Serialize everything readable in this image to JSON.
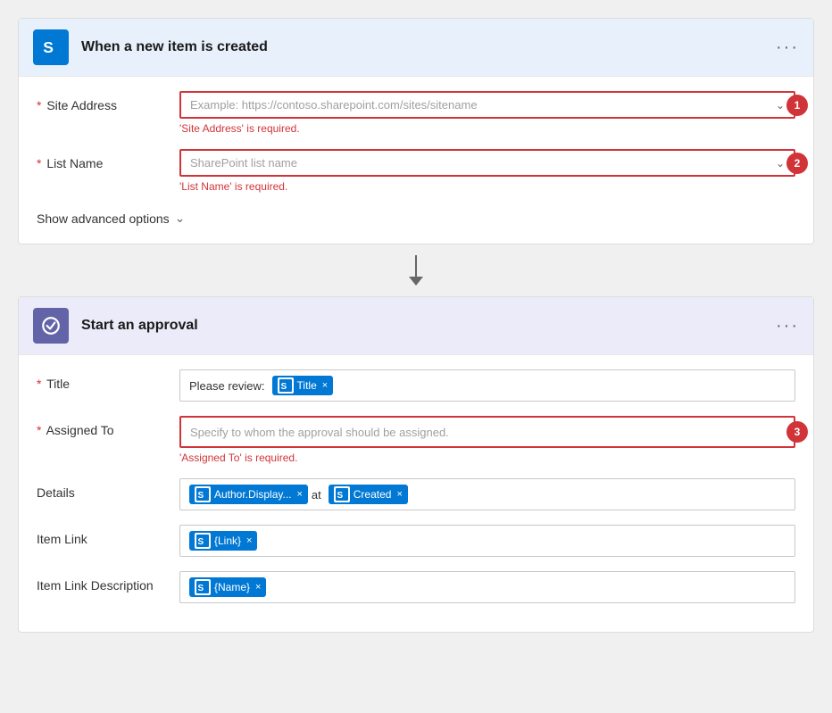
{
  "trigger_card": {
    "title": "When a new item is created",
    "icon_label": "S",
    "menu_dots": "···",
    "site_address": {
      "label": "Site Address",
      "required": true,
      "placeholder": "Example: https://contoso.sharepoint.com/sites/sitename",
      "error": "'Site Address' is required.",
      "step_badge": "1"
    },
    "list_name": {
      "label": "List Name",
      "required": true,
      "placeholder": "SharePoint list name",
      "error": "'List Name' is required.",
      "step_badge": "2"
    },
    "advanced_options": {
      "label": "Show advanced options"
    }
  },
  "approval_card": {
    "title": "Start an approval",
    "icon_label": "✓",
    "menu_dots": "···",
    "title_field": {
      "label": "Title",
      "required": true,
      "prefix_text": "Please review:",
      "token_label": "Title",
      "token_icon": "S"
    },
    "assigned_to": {
      "label": "Assigned To",
      "required": true,
      "placeholder": "Specify to whom the approval should be assigned.",
      "error": "'Assigned To' is required.",
      "step_badge": "3"
    },
    "details": {
      "label": "Details",
      "token1_label": "Author.Display...",
      "token1_icon": "S",
      "separator": "at",
      "token2_label": "Created",
      "token2_icon": "S"
    },
    "item_link": {
      "label": "Item Link",
      "token_label": "{Link}",
      "token_icon": "S"
    },
    "item_link_description": {
      "label": "Item Link Description",
      "token_label": "{Name}",
      "token_icon": "S"
    }
  },
  "colors": {
    "sharepoint_blue": "#0078d4",
    "approval_purple": "#6264a7",
    "error_red": "#d13438",
    "badge_red": "#d13438"
  }
}
